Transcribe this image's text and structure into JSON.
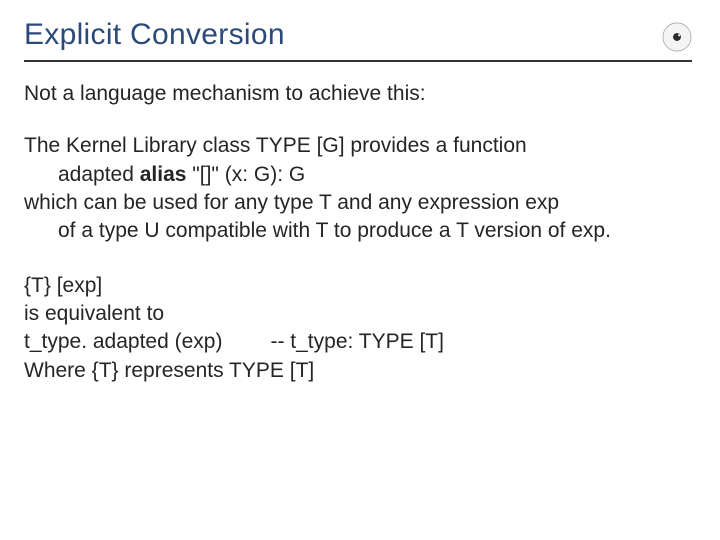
{
  "title": "Explicit Conversion",
  "intro": "Not a language mechanism to achieve this:",
  "para1": {
    "line1": "The Kernel Library class TYPE [G] provides a function",
    "func_prefix": "adapted ",
    "func_alias": "alias",
    "func_suffix": " \"[]\" (x: G): G",
    "line3": "which can be used for any type T and any expression exp of a type U compatible with T to produce a T version of exp."
  },
  "para2": {
    "l1": "{T} [exp]",
    "l2": "is equivalent to",
    "l3a": "t_type. adapted (exp)",
    "l3b": "-- t_type: TYPE [T]",
    "l4": "Where {T} represents TYPE [T]"
  },
  "logo": {
    "name": "chair-of-software-engineering-logo"
  }
}
